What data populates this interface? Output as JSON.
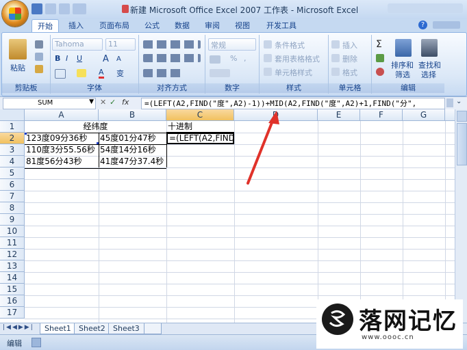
{
  "window": {
    "title": "新建 Microsoft Office Excel 2007 工作表 - Microsoft Excel"
  },
  "tabs": [
    "开始",
    "插入",
    "页面布局",
    "公式",
    "数据",
    "审阅",
    "视图",
    "开发工具"
  ],
  "ribbon": {
    "clipboard": {
      "paste": "粘贴",
      "label": "剪贴板"
    },
    "font": {
      "name": "Tahoma",
      "size": "11",
      "label": "字体",
      "bold": "B",
      "italic": "I",
      "underline": "U",
      "grow": "A",
      "shrink": "A",
      "color": "A",
      "wen": "变"
    },
    "alignment": {
      "label": "对齐方式"
    },
    "number": {
      "format": "常规",
      "percent": "%",
      "comma": ",",
      "label": "数字"
    },
    "styles": {
      "cond": "条件格式",
      "table": "套用表格格式",
      "cell": "单元格样式",
      "label": "样式"
    },
    "cells": {
      "insert": "插入",
      "delete": "删除",
      "format": "格式",
      "label": "单元格"
    },
    "editing": {
      "sum": "Σ",
      "sort": "排序和",
      "sort2": "筛选",
      "find": "查找和",
      "find2": "选择",
      "label": "编辑"
    }
  },
  "formula_bar": {
    "name_box": "SUM",
    "fx": "fx",
    "formula": "=(LEFT(A2,FIND(\"度\",A2)-1))+MID(A2,FIND(\"度\",A2)+1,FIND(\"分\","
  },
  "sheet": {
    "columns": [
      "A",
      "B",
      "C",
      "D",
      "E",
      "F",
      "G"
    ],
    "rows": [
      "1",
      "2",
      "3",
      "4",
      "5",
      "6",
      "7",
      "8",
      "9",
      "10",
      "11",
      "12",
      "13",
      "14",
      "15",
      "16",
      "17"
    ],
    "cells": {
      "A1": "经纬度",
      "C1": "十进制",
      "A2": "123度09分36秒",
      "B2": "45度01分47秒",
      "C2": "=(LEFT(A2,FIND",
      "A3": "110度3分55.56秒",
      "B3": "54度14分16秒",
      "A4": "81度56分43秒",
      "B4": "41度47分37.4秒"
    }
  },
  "sheet_tabs": [
    "Sheet1",
    "Sheet2",
    "Sheet3"
  ],
  "status": {
    "mode": "编辑"
  },
  "watermark": {
    "title": "落网记忆",
    "url": "www.oooc.cn"
  },
  "colors": {
    "accent": "#15428b",
    "arrow": "#e0322a",
    "selected_header": "#f1c15f"
  }
}
